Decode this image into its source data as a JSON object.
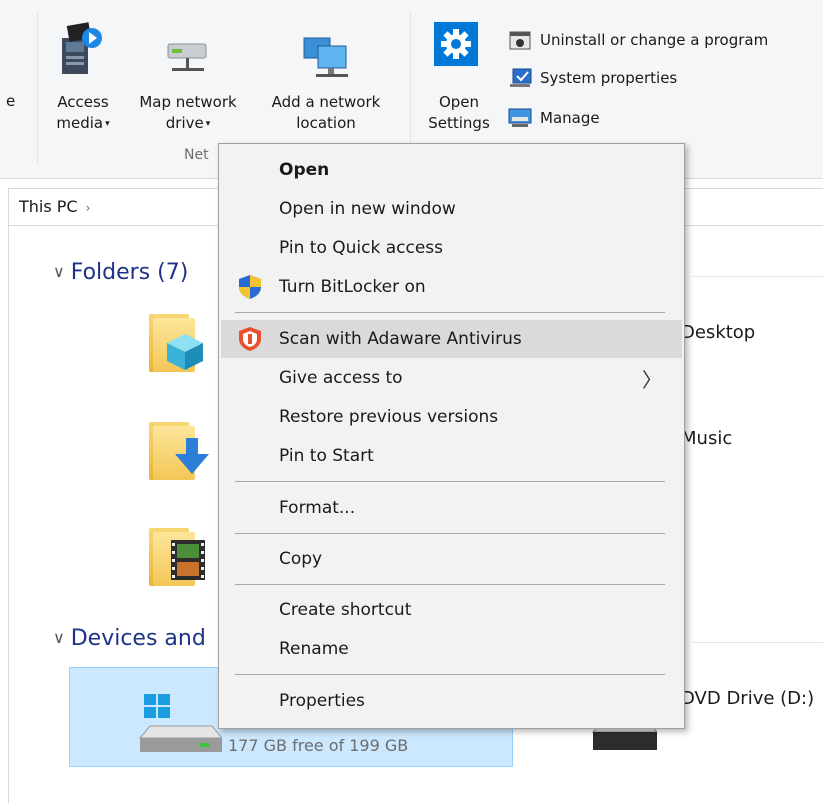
{
  "ribbon": {
    "partial_label": "e",
    "access_media": {
      "line1": "Access",
      "line2": "media"
    },
    "map_network": {
      "line1": "Map network",
      "line2": "drive"
    },
    "add_network": {
      "line1": "Add a network",
      "line2": "location"
    },
    "open_settings": {
      "line1": "Open",
      "line2": "Settings"
    },
    "uninstall": "Uninstall or change a program",
    "system_properties": "System properties",
    "manage": "Manage",
    "group_network_partial": "Net",
    "caret": "▾"
  },
  "address": {
    "crumb": "This PC",
    "chevron": "›"
  },
  "sections": {
    "folders": "Folders (7)",
    "devices_partial": "Devices and",
    "collapse_arrow": "∨"
  },
  "items": {
    "desktop": "Desktop",
    "music": "Music",
    "dvd": "DVD Drive (D:)",
    "local_disk_free": "177 GB free of 199 GB"
  },
  "context_menu": {
    "open": "Open",
    "open_new_window": "Open in new window",
    "pin_quick_access": "Pin to Quick access",
    "bitlocker": "Turn BitLocker on",
    "adaware": "Scan with Adaware Antivirus",
    "give_access": "Give access to",
    "restore_versions": "Restore previous versions",
    "pin_start": "Pin to Start",
    "format": "Format...",
    "copy": "Copy",
    "create_shortcut": "Create shortcut",
    "rename": "Rename",
    "properties": "Properties",
    "submenu_arrow": "〉"
  },
  "colors": {
    "accent_blue": "#0078d7",
    "selection": "#cce8ff",
    "section_header": "#1e3287",
    "adaware_red": "#e8502f"
  }
}
